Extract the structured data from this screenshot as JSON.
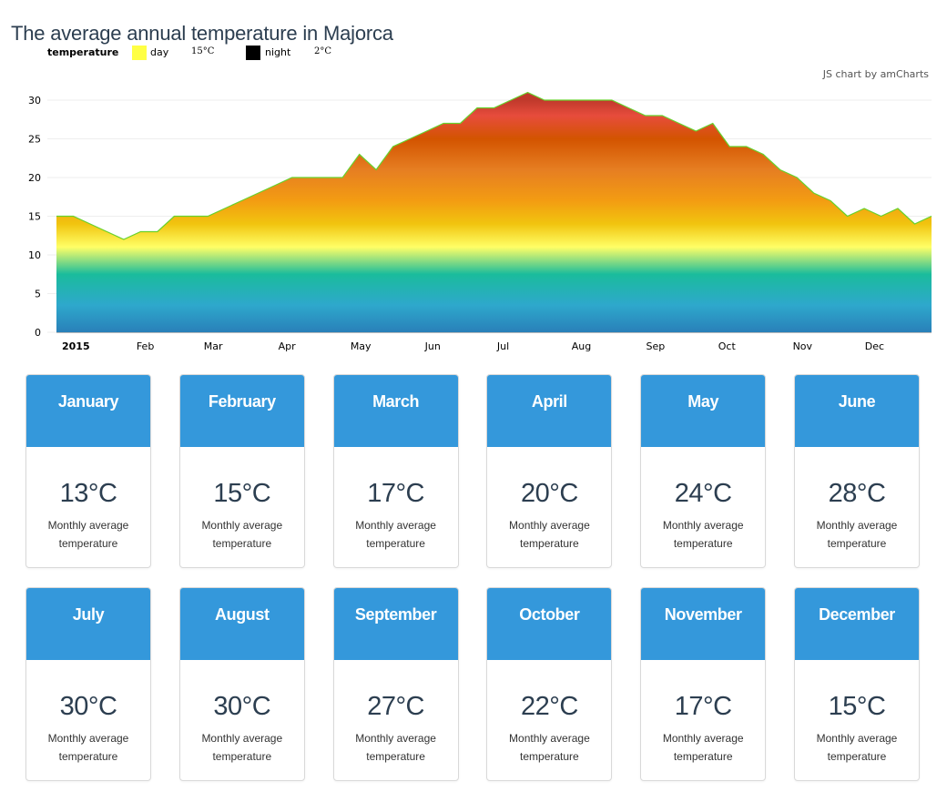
{
  "page": {
    "title": "The average annual temperature in Majorca"
  },
  "legend": {
    "title": "temperature",
    "items": [
      {
        "label": "day",
        "value": "15°C",
        "color": "#ffff44"
      },
      {
        "label": "night",
        "value": "2°C",
        "color": "#000000"
      }
    ]
  },
  "credit": "JS chart by amCharts",
  "chart_data": {
    "type": "area",
    "title": "The average annual temperature in Majorca",
    "xlabel": "",
    "ylabel": "",
    "ylim": [
      0,
      30
    ],
    "yticks": [
      0,
      5,
      10,
      15,
      20,
      25,
      30
    ],
    "grid": true,
    "x_unit": "week of 2015",
    "x_tick_labels": [
      {
        "label": "2015",
        "day": 0,
        "bold": true
      },
      {
        "label": "Feb",
        "day": 31
      },
      {
        "label": "Mar",
        "day": 59
      },
      {
        "label": "Apr",
        "day": 90
      },
      {
        "label": "May",
        "day": 120
      },
      {
        "label": "Jun",
        "day": 151
      },
      {
        "label": "Jul",
        "day": 181
      },
      {
        "label": "Aug",
        "day": 212
      },
      {
        "label": "Sep",
        "day": 243
      },
      {
        "label": "Oct",
        "day": 273
      },
      {
        "label": "Nov",
        "day": 304
      },
      {
        "label": "Dec",
        "day": 334
      }
    ],
    "series": [
      {
        "name": "temperature",
        "x_days": [
          0,
          7,
          14,
          21,
          28,
          35,
          42,
          49,
          56,
          63,
          70,
          77,
          84,
          91,
          98,
          105,
          112,
          119,
          126,
          133,
          140,
          147,
          154,
          161,
          168,
          175,
          182,
          189,
          196,
          203,
          210,
          217,
          224,
          231,
          238,
          245,
          252,
          259,
          266,
          273,
          280,
          287,
          294,
          301,
          308,
          315,
          322,
          329,
          336,
          343,
          350,
          357,
          364
        ],
        "values": [
          15,
          15,
          14,
          13,
          12,
          13,
          13,
          15,
          15,
          15,
          16,
          17,
          18,
          19,
          20,
          20,
          20,
          20,
          23,
          21,
          24,
          25,
          26,
          27,
          27,
          29,
          29,
          30,
          31,
          30,
          30,
          30,
          30,
          30,
          29,
          28,
          28,
          27,
          26,
          27,
          24,
          24,
          23,
          21,
          20,
          18,
          17,
          15,
          16,
          15,
          16,
          14,
          15
        ]
      }
    ],
    "gradient_stops": [
      {
        "value": 30,
        "color": "#c0392b"
      },
      {
        "value": 28,
        "color": "#e74c3c"
      },
      {
        "value": 25,
        "color": "#d35400"
      },
      {
        "value": 21,
        "color": "#e67e22"
      },
      {
        "value": 17,
        "color": "#f39c12"
      },
      {
        "value": 14,
        "color": "#f1c40f"
      },
      {
        "value": 11,
        "color": "#ffff66"
      },
      {
        "value": 7.5,
        "color": "#1abc9c"
      },
      {
        "value": 3.5,
        "color": "#2ea8cc"
      },
      {
        "value": 0,
        "color": "#2980b9"
      }
    ],
    "line_color": "#67d22c"
  },
  "cards": [
    {
      "month": "January",
      "temp": "13°C",
      "desc": "Monthly average temperature"
    },
    {
      "month": "February",
      "temp": "15°C",
      "desc": "Monthly average temperature"
    },
    {
      "month": "March",
      "temp": "17°C",
      "desc": "Monthly average temperature"
    },
    {
      "month": "April",
      "temp": "20°C",
      "desc": "Monthly average temperature"
    },
    {
      "month": "May",
      "temp": "24°C",
      "desc": "Monthly average temperature"
    },
    {
      "month": "June",
      "temp": "28°C",
      "desc": "Monthly average temperature"
    },
    {
      "month": "July",
      "temp": "30°C",
      "desc": "Monthly average temperature"
    },
    {
      "month": "August",
      "temp": "30°C",
      "desc": "Monthly average temperature"
    },
    {
      "month": "September",
      "temp": "27°C",
      "desc": "Monthly average temperature"
    },
    {
      "month": "October",
      "temp": "22°C",
      "desc": "Monthly average temperature"
    },
    {
      "month": "November",
      "temp": "17°C",
      "desc": "Monthly average temperature"
    },
    {
      "month": "December",
      "temp": "15°C",
      "desc": "Monthly average temperature"
    }
  ],
  "colors": {
    "card_header": "#3498db",
    "text_dark": "#2c3e50"
  }
}
